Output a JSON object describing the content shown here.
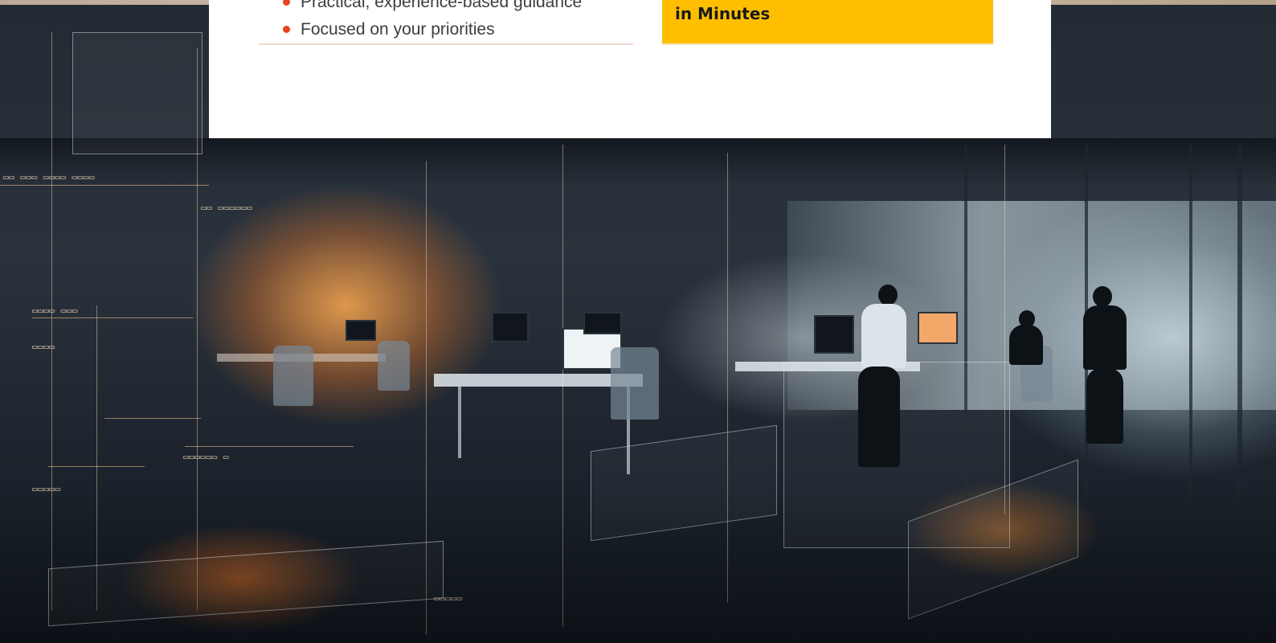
{
  "benefits": {
    "items": [
      "Practical, experience-based guidance",
      "Focused on your priorities"
    ]
  },
  "cta": {
    "title_tail": "in Minutes",
    "background": "#FFBF00"
  },
  "colors": {
    "bullet": "#E8451C",
    "card": "#FFFFFF"
  },
  "hero": {
    "image_description_icon": "office-hologram-image"
  }
}
